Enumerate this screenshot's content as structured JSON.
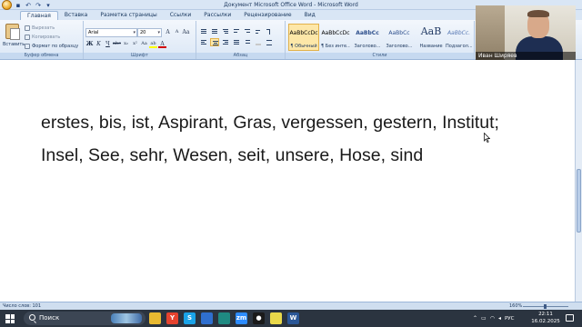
{
  "window": {
    "title": "Документ Microsoft Office Word - Microsoft Word",
    "controls": [
      "–",
      "□",
      "✕"
    ]
  },
  "quick_access": [
    "↶",
    "↷",
    "▾"
  ],
  "tabs": [
    "Главная",
    "Вставка",
    "Разметка страницы",
    "Ссылки",
    "Рассылки",
    "Рецензирование",
    "Вид"
  ],
  "ribbon": {
    "clipboard": {
      "paste": "Вставить",
      "cut": "Вырезать",
      "copy": "Копировать",
      "format_painter": "Формат по образцу",
      "label": "Буфер обмена"
    },
    "font": {
      "name": "Arial",
      "size": "20",
      "grow": "A",
      "shrink": "A",
      "clear": "Aa",
      "bold": "Ж",
      "italic": "К",
      "underline": "Ч",
      "strike": "abc",
      "sub": "x₂",
      "sup": "x²",
      "case": "Aa",
      "highlight": "ab",
      "color": "A",
      "label": "Шрифт"
    },
    "paragraph": {
      "label": "Абзац"
    },
    "styles": {
      "items": [
        {
          "sample": "AaBbCcDc",
          "name": "¶ Обычный"
        },
        {
          "sample": "AaBbCcDc",
          "name": "¶ Без инте..."
        },
        {
          "sample": "AaBbCc",
          "name": "Заголово..."
        },
        {
          "sample": "AaBbCc",
          "name": "Заголово..."
        },
        {
          "sample": "AaB",
          "name": "Название"
        },
        {
          "sample": "AaBbCc.",
          "name": "Подзагол..."
        }
      ],
      "label": "Стили"
    }
  },
  "document": {
    "line1": "erstes, bis, ist, Aspirant, Gras, vergessen, gestern, Institut;",
    "line2": "Insel, See, sehr, Wesen, seit, unsere, Hose, sind"
  },
  "webcam": {
    "name": "Иван Ширяев"
  },
  "statusbar": {
    "word_count": "Число слов: 101",
    "zoom": "160%"
  },
  "taskbar": {
    "search_placeholder": "Поиск",
    "apps": [
      {
        "icon": "file-explorer-icon",
        "glyph": "",
        "color": "#e8b931"
      },
      {
        "icon": "yandex-browser-icon",
        "glyph": "Y",
        "color": "#e5432f"
      },
      {
        "icon": "skype-icon",
        "glyph": "S",
        "color": "#1aa3e8"
      },
      {
        "icon": "app-icon",
        "glyph": "",
        "color": "#2f6fcf"
      },
      {
        "icon": "app-teal-icon",
        "glyph": "",
        "color": "#1f8a82"
      },
      {
        "icon": "zoom-icon",
        "glyph": "zm",
        "color": "#2d8cff"
      },
      {
        "icon": "media-player-icon",
        "glyph": "●",
        "color": "#1a1a1a"
      },
      {
        "icon": "sticky-notes-icon",
        "glyph": "",
        "color": "#e9d84a"
      },
      {
        "icon": "word-icon",
        "glyph": "W",
        "color": "#2b5797"
      }
    ],
    "lang": "РУС",
    "time": "22:11",
    "date": "16.02.2025"
  },
  "colors": {
    "ribbon_bg": "#dbe7f6",
    "taskbar_bg": "#2b3440",
    "active_style": "#fde7a8"
  }
}
